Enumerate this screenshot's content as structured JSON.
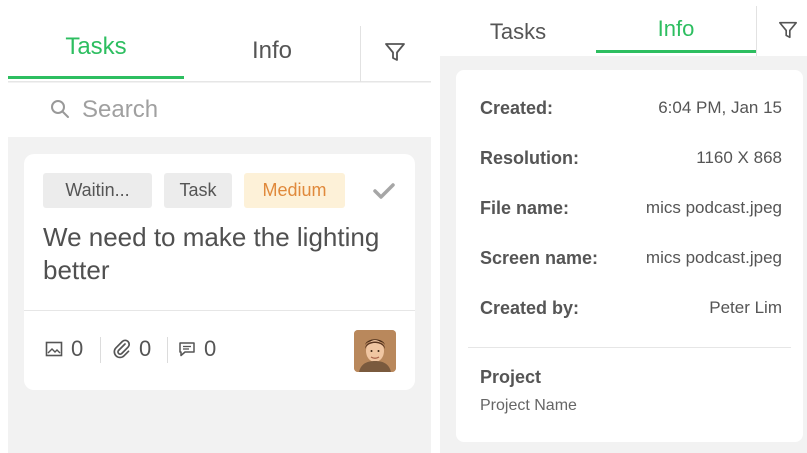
{
  "left_panel": {
    "tabs": [
      {
        "label": "Tasks",
        "active": true
      },
      {
        "label": "Info",
        "active": false
      }
    ],
    "filter_icon": "filter-icon",
    "search": {
      "placeholder": "Search",
      "value": ""
    },
    "task_card": {
      "status": "Waitin...",
      "type": "Task",
      "priority": "Medium",
      "title": "We need to make the lighting better",
      "counts": {
        "images": "0",
        "attachments": "0",
        "comments": "0"
      },
      "icons": [
        "image-icon",
        "paperclip-icon",
        "comment-icon",
        "checkmark-icon"
      ]
    }
  },
  "right_panel": {
    "tabs": [
      {
        "label": "Tasks",
        "active": false
      },
      {
        "label": "Info",
        "active": true
      }
    ],
    "filter_icon": "filter-icon",
    "info": {
      "rows": [
        {
          "key": "Created:",
          "value": "6:04 PM, Jan 15"
        },
        {
          "key": "Resolution:",
          "value": "1160 X 868"
        },
        {
          "key": "File name:",
          "value": "mics podcast.jpeg"
        },
        {
          "key": "Screen name:",
          "value": "mics podcast.jpeg"
        },
        {
          "key": "Created by:",
          "value": "Peter Lim"
        }
      ],
      "project_label": "Project",
      "project_name": "Project Name"
    }
  },
  "colors": {
    "accent": "#2dbe60",
    "priority_text": "#e0893b",
    "priority_bg": "#fdf1d8",
    "panel_bg": "#f2f2f2"
  }
}
